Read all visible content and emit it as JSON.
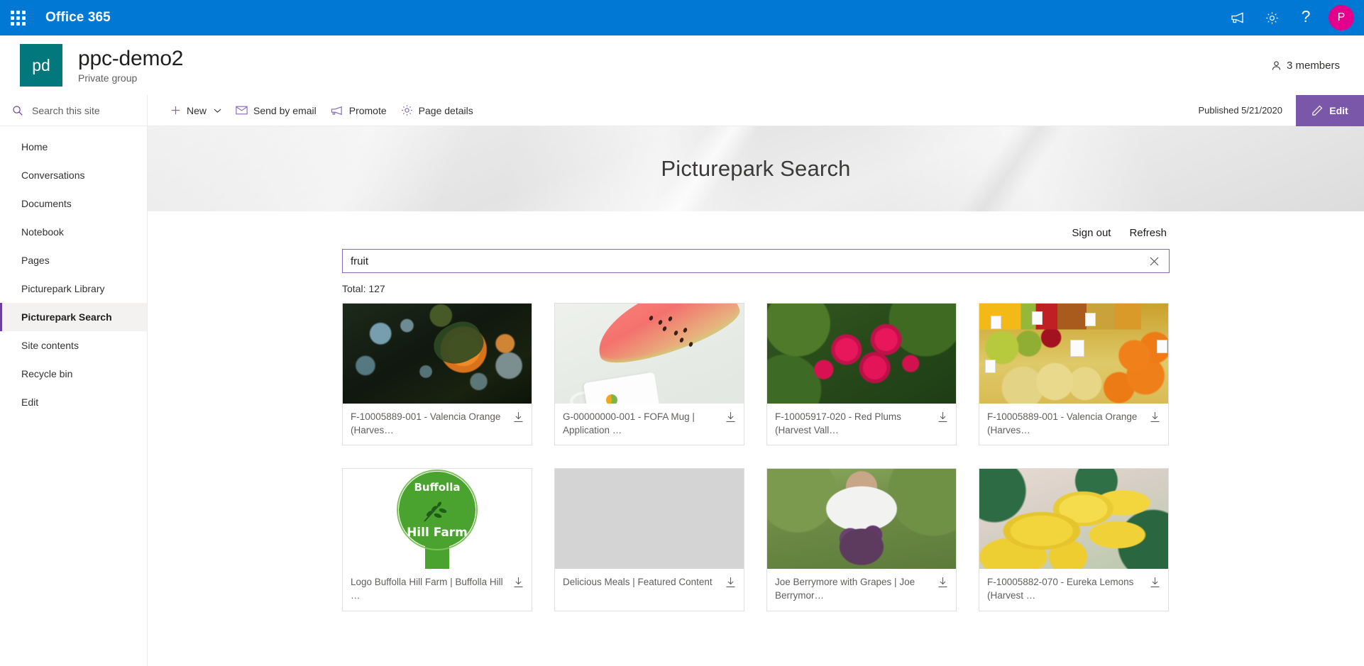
{
  "suite": {
    "brand": "Office 365",
    "waffle_name": "app-launcher",
    "icons": [
      "megaphone-icon",
      "gear-icon",
      "help-icon"
    ],
    "avatar_initial": "P",
    "avatar_color": "#e3008c",
    "bar_color": "#0078d4"
  },
  "site": {
    "logo_initials": "pd",
    "logo_color": "#03787c",
    "title": "ppc-demo2",
    "subtitle": "Private group",
    "members_label": "3 members"
  },
  "commandbar": {
    "new_label": "New",
    "send_by_email_label": "Send by email",
    "promote_label": "Promote",
    "page_details_label": "Page details",
    "published_label": "Published 5/21/2020",
    "edit_label": "Edit",
    "edit_color": "#7a57a8"
  },
  "leftnav": {
    "search_placeholder": "Search this site",
    "items": [
      {
        "label": "Home",
        "selected": false
      },
      {
        "label": "Conversations",
        "selected": false
      },
      {
        "label": "Documents",
        "selected": false
      },
      {
        "label": "Notebook",
        "selected": false
      },
      {
        "label": "Pages",
        "selected": false
      },
      {
        "label": "Picturepark Library",
        "selected": false
      },
      {
        "label": "Picturepark Search",
        "selected": true
      },
      {
        "label": "Site contents",
        "selected": false
      },
      {
        "label": "Recycle bin",
        "selected": false
      },
      {
        "label": "Edit",
        "selected": false
      }
    ],
    "selected_accent": "#6b3fa0"
  },
  "hero": {
    "title": "Picturepark Search"
  },
  "webpart": {
    "sign_out_label": "Sign out",
    "refresh_label": "Refresh",
    "search_value": "fruit",
    "search_placeholder": "",
    "clear_icon": "close-icon",
    "total_label": "Total: 127",
    "total_count": 127,
    "search_border_color": "#8764b8",
    "results": [
      {
        "caption": "F-10005889-001 - Valencia Orange (Harves…",
        "art": "img-orange"
      },
      {
        "caption": "G-00000000-001 - FOFA Mug | Application …",
        "art": "img-melon"
      },
      {
        "caption": "F-10005917-020 - Red Plums (Harvest Vall…",
        "art": "img-plums"
      },
      {
        "caption": "F-10005889-001 - Valencia Orange (Harves…",
        "art": "img-market"
      },
      {
        "caption": "Logo Buffolla Hill Farm | Buffolla Hill …",
        "art": "img-logo"
      },
      {
        "caption": "Delicious Meals | Featured Content",
        "art": "img-empty"
      },
      {
        "caption": "Joe Berrymore with Grapes | Joe Berrymor…",
        "art": "img-grapes"
      },
      {
        "caption": "F-10005882-070 - Eureka Lemons (Harvest …",
        "art": "img-lemons"
      }
    ],
    "logo_art": {
      "top_text": "Buffolla",
      "bottom_text": "Hill Farm",
      "color": "#4aa32e"
    }
  }
}
